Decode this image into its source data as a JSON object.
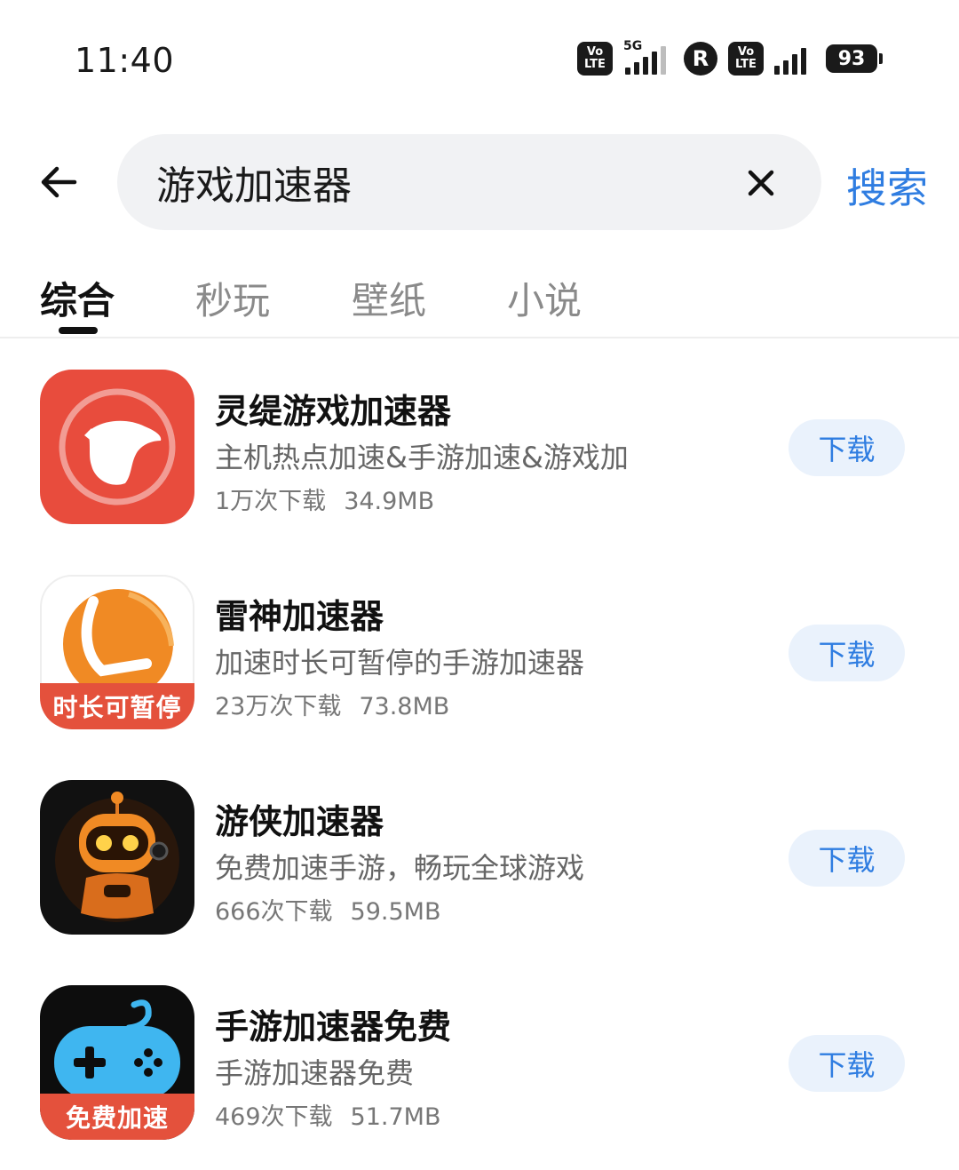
{
  "status_bar": {
    "time": "11:40",
    "network_5g": "5G",
    "volte_top": "Vo",
    "volte_bottom": "LTE",
    "r_label": "R",
    "battery": "93"
  },
  "search": {
    "query": "游戏加速器",
    "search_button_label": "搜索"
  },
  "tabs": [
    {
      "label": "综合",
      "active": true
    },
    {
      "label": "秒玩",
      "active": false
    },
    {
      "label": "壁纸",
      "active": false
    },
    {
      "label": "小说",
      "active": false
    }
  ],
  "apps": [
    {
      "name": "灵缇游戏加速器",
      "description": "主机热点加速&手游加速&游戏加",
      "downloads": "1万次下载",
      "size": "34.9MB",
      "button": "下载",
      "icon": "greyhound-logo-icon",
      "color": "#e84c3d"
    },
    {
      "name": "雷神加速器",
      "description": "加速时长可暂停的手游加速器",
      "downloads": "23万次下载",
      "size": "73.8MB",
      "button": "下载",
      "icon": "orange-ball-logo-icon",
      "badge": "时长可暂停",
      "color": "#f08a24"
    },
    {
      "name": "游侠加速器",
      "description": "免费加速手游，畅玩全球游戏",
      "downloads": "666次下载",
      "size": "59.5MB",
      "button": "下载",
      "icon": "robot-logo-icon",
      "color": "#111111"
    },
    {
      "name": "手游加速器免费",
      "description": "手游加速器免费",
      "downloads": "469次下载",
      "size": "51.7MB",
      "button": "下载",
      "icon": "gamepad-logo-icon",
      "badge": "免费加速",
      "color": "#3fb6f0"
    }
  ],
  "colors": {
    "accent": "#2f7de1",
    "button_bg": "#eaf2fc",
    "search_bg": "#f1f2f4"
  }
}
